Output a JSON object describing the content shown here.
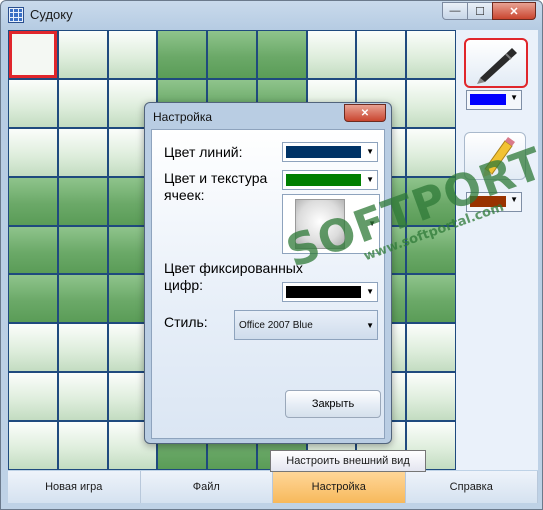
{
  "window": {
    "title": "Судоку",
    "minimize": "—",
    "maximize": "☐",
    "close": "✕"
  },
  "grid": {
    "rows": 9,
    "cols": 9,
    "dark_cells": [
      [
        0,
        3
      ],
      [
        0,
        4
      ],
      [
        0,
        5
      ],
      [
        1,
        3
      ],
      [
        1,
        4
      ],
      [
        1,
        5
      ],
      [
        2,
        3
      ],
      [
        2,
        4
      ],
      [
        2,
        5
      ],
      [
        3,
        0
      ],
      [
        3,
        1
      ],
      [
        3,
        2
      ],
      [
        3,
        6
      ],
      [
        3,
        7
      ],
      [
        3,
        8
      ],
      [
        4,
        0
      ],
      [
        4,
        1
      ],
      [
        4,
        2
      ],
      [
        4,
        6
      ],
      [
        4,
        7
      ],
      [
        4,
        8
      ],
      [
        5,
        0
      ],
      [
        5,
        1
      ],
      [
        5,
        2
      ],
      [
        5,
        6
      ],
      [
        5,
        7
      ],
      [
        5,
        8
      ],
      [
        6,
        3
      ],
      [
        6,
        4
      ],
      [
        6,
        5
      ],
      [
        7,
        3
      ],
      [
        7,
        4
      ],
      [
        7,
        5
      ],
      [
        8,
        3
      ],
      [
        8,
        4
      ],
      [
        8,
        5
      ]
    ],
    "selected_cell": [
      0,
      0
    ]
  },
  "side": {
    "pen_color": "#0000ff",
    "pencil_color": "#993300",
    "pen_icon": "pen-icon",
    "pencil_icon": "pencil-icon"
  },
  "dialog": {
    "title": "Настройка",
    "close": "✕",
    "line_color_label": "Цвет линий:",
    "line_color": "#003366",
    "cell_color_label": "Цвет и текстура ячеек:",
    "cell_color": "#007f00",
    "fixed_digits_label": "Цвет фиксированных цифр:",
    "fixed_digits_color": "#000000",
    "style_label": "Стиль:",
    "style_value": "Office 2007 Blue",
    "ok_button": "Закрыть"
  },
  "tooltip": "Настроить внешний вид",
  "menu": [
    "Новая игра",
    "Файл",
    "Настройка",
    "Справка"
  ],
  "menu_active": 2,
  "watermark": {
    "line1": "SOFTPORTAL",
    "line2": "www.softportal.com"
  }
}
